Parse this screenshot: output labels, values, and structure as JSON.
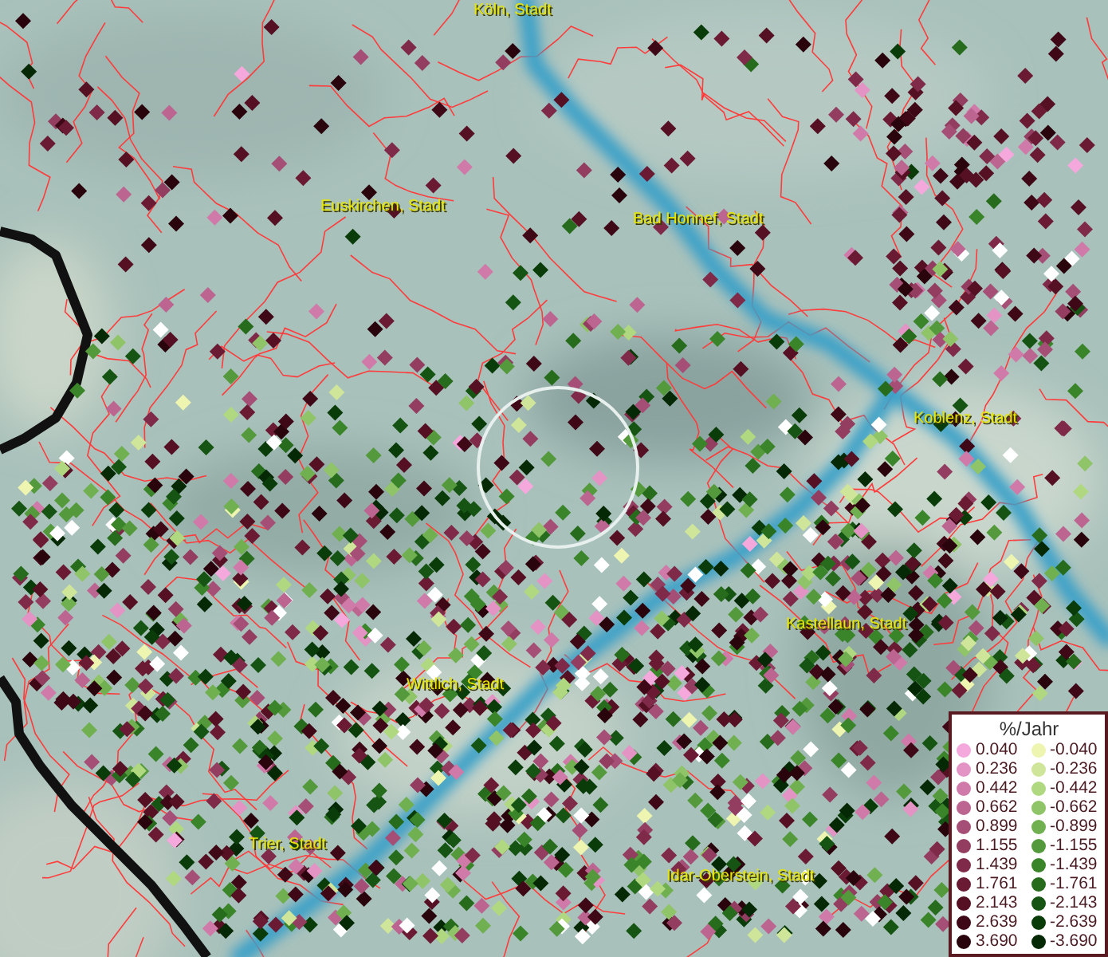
{
  "map": {
    "places": [
      {
        "label": "Köln, Stadt"
      },
      {
        "label": "Euskirchen, Stadt"
      },
      {
        "label": "Bad Honnef, Stadt"
      },
      {
        "label": "Koblenz, Stadt"
      },
      {
        "label": "Kastellaun, Stadt"
      },
      {
        "label": "Wittlich, Stadt"
      },
      {
        "label": "Trier, Stadt"
      },
      {
        "label": "Idar-Oberstein, Stadt"
      }
    ]
  },
  "legend": {
    "title": "%/Jahr",
    "positive": [
      {
        "label": "0.040",
        "color": "#f4a8dc"
      },
      {
        "label": "0.236",
        "color": "#e393c4"
      },
      {
        "label": "0.442",
        "color": "#cf7aa8"
      },
      {
        "label": "0.662",
        "color": "#bb6590"
      },
      {
        "label": "0.899",
        "color": "#a64f76"
      },
      {
        "label": "1.155",
        "color": "#933d60"
      },
      {
        "label": "1.439",
        "color": "#7f2a48"
      },
      {
        "label": "1.761",
        "color": "#6a1a33"
      },
      {
        "label": "2.143",
        "color": "#551024"
      },
      {
        "label": "2.639",
        "color": "#3e0816"
      },
      {
        "label": "3.690",
        "color": "#2a040c"
      }
    ],
    "negative": [
      {
        "label": "-0.040",
        "color": "#eef5b0"
      },
      {
        "label": "-0.236",
        "color": "#cfe69a"
      },
      {
        "label": "-0.442",
        "color": "#b0d880"
      },
      {
        "label": "-0.662",
        "color": "#90c468"
      },
      {
        "label": "-0.899",
        "color": "#70b050"
      },
      {
        "label": "-1.155",
        "color": "#549a3c"
      },
      {
        "label": "-1.439",
        "color": "#3a842a"
      },
      {
        "label": "-1.761",
        "color": "#266c1c"
      },
      {
        "label": "-2.143",
        "color": "#155412"
      },
      {
        "label": "-2.639",
        "color": "#0a3c0a"
      },
      {
        "label": "-3.690",
        "color": "#052805"
      }
    ]
  }
}
